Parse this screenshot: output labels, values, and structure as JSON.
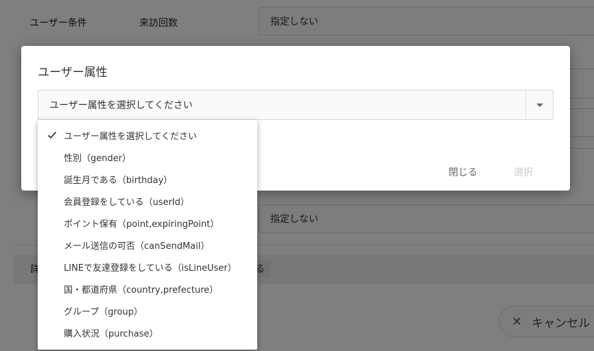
{
  "background": {
    "row1_label": "ユーザー条件",
    "row1_sublabel": "来訪回数",
    "row1_value": "指定しない",
    "row2_value": "指定しない",
    "detail_label": "詳",
    "detail_chip": "る",
    "cancel_label": "キャンセル"
  },
  "dialog": {
    "title": "ユーザー属性",
    "select_value": "ユーザー属性を選択してください",
    "close_label": "閉じる",
    "select_label": "選択"
  },
  "menu": {
    "items": [
      {
        "label": "ユーザー属性を選択してください",
        "selected": true
      },
      {
        "label": "性別（gender）",
        "selected": false
      },
      {
        "label": "誕生月である（birthday）",
        "selected": false
      },
      {
        "label": "会員登録をしている（userId）",
        "selected": false
      },
      {
        "label": "ポイント保有（point,expiringPoint）",
        "selected": false
      },
      {
        "label": "メール送信の可否（canSendMail）",
        "selected": false
      },
      {
        "label": "LINEで友達登録をしている（isLineUser）",
        "selected": false
      },
      {
        "label": "国・都道府県（country,prefecture）",
        "selected": false
      },
      {
        "label": "グループ（group）",
        "selected": false
      },
      {
        "label": "購入状況（purchase）",
        "selected": false
      }
    ]
  },
  "icons": {
    "check": "check-icon",
    "dropdown": "chevron-down-icon",
    "close": "close-icon"
  },
  "colors": {
    "overlay": "rgba(0,0,0,0.5)",
    "disabled_text": "#cccccc"
  }
}
